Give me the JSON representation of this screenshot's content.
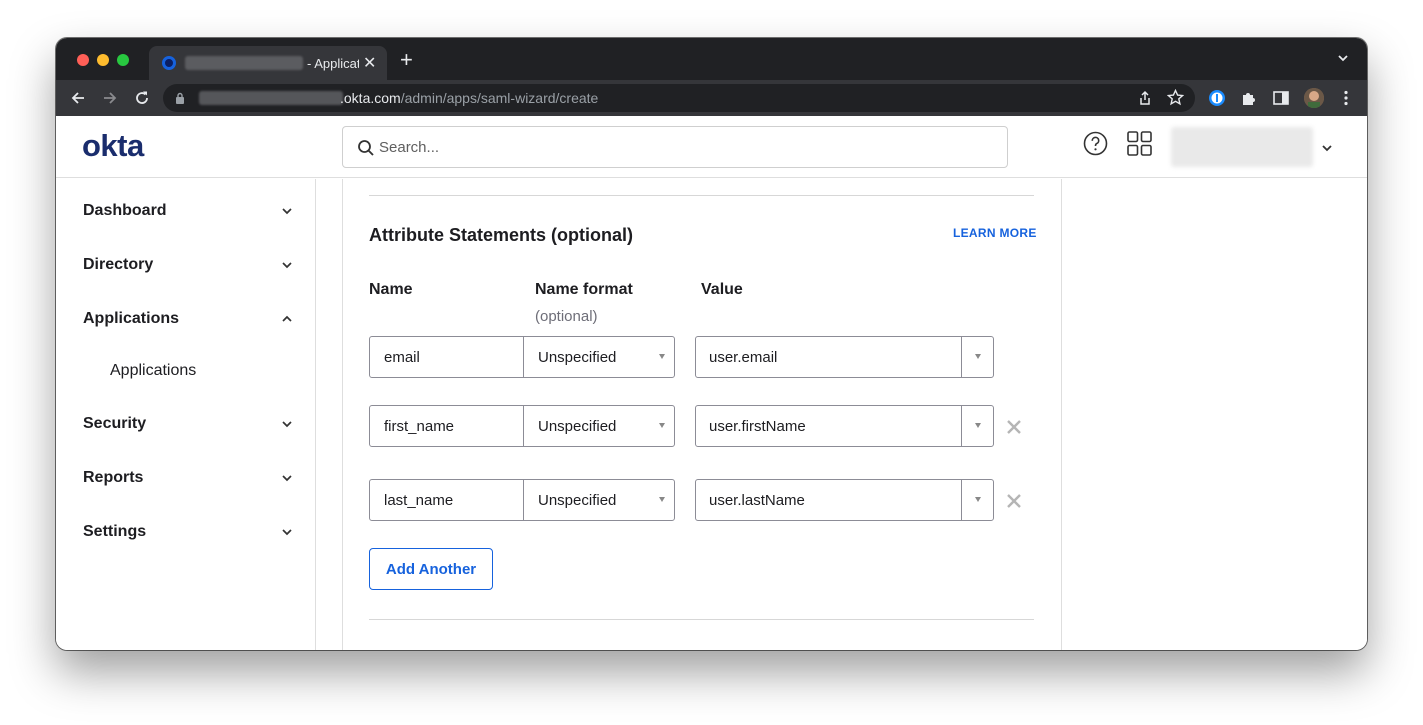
{
  "browser": {
    "tab_title": "- Applicat",
    "tab_close": "✕",
    "new_tab": "+",
    "url_host": ".okta.com",
    "url_path": "/admin/apps/saml-wizard/create"
  },
  "header": {
    "logo": "okta",
    "search_placeholder": "Search..."
  },
  "sidebar": {
    "items": [
      {
        "label": "Dashboard"
      },
      {
        "label": "Directory"
      },
      {
        "label": "Applications"
      },
      {
        "label": "Applications"
      },
      {
        "label": "Security"
      },
      {
        "label": "Reports"
      },
      {
        "label": "Settings"
      }
    ]
  },
  "main": {
    "section_title": "Attribute Statements (optional)",
    "learn_more": "LEARN MORE",
    "columns": {
      "name": "Name",
      "name_format": "Name format",
      "name_format_sub": "(optional)",
      "value": "Value"
    },
    "rows": [
      {
        "name": "email",
        "format": "Unspecified",
        "value": "user.email"
      },
      {
        "name": "first_name",
        "format": "Unspecified",
        "value": "user.firstName"
      },
      {
        "name": "last_name",
        "format": "Unspecified",
        "value": "user.lastName"
      }
    ],
    "add_button": "Add Another"
  },
  "colors": {
    "okta_navy": "#1a2d6d",
    "link_blue": "#1662dd",
    "chrome_dark": "#202124",
    "chrome_toolbar": "#35363a"
  }
}
